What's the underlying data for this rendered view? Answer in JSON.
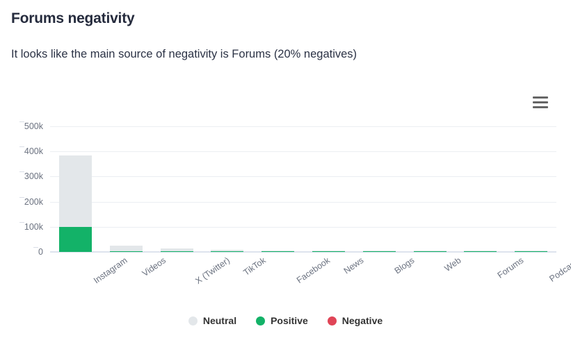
{
  "header": {
    "title": "Forums negativity",
    "subtitle": "It looks like the main source of negativity is Forums (20% negatives)"
  },
  "toolbar": {
    "menu_label": "Chart context menu",
    "menu_icon": "hamburger-menu-icon"
  },
  "colors": {
    "neutral": "#e3e7ea",
    "positive": "#13b268",
    "negative": "#e04557",
    "gridline": "#ebeef2",
    "axis": "#dde3ee",
    "tick_text": "#6b7280",
    "title_text": "#252b3d"
  },
  "chart_data": {
    "type": "bar",
    "subtype": "stacked-column",
    "title": "Forums negativity",
    "subtitle": "It looks like the main source of negativity is Forums (20% negatives)",
    "xlabel": "",
    "ylabel": "",
    "ylim": [
      0,
      500000
    ],
    "grid": true,
    "legend_position": "bottom",
    "categories": [
      "Instagram",
      "Videos",
      "X (Twitter)",
      "TikTok",
      "Facebook",
      "News",
      "Blogs",
      "Web",
      "Forums",
      "Podcasts"
    ],
    "ytick_labels": [
      "0",
      "100k",
      "200k",
      "300k",
      "400k",
      "500k"
    ],
    "ytick_values": [
      0,
      100000,
      200000,
      300000,
      400000,
      500000
    ],
    "series": [
      {
        "name": "Neutral",
        "color": "#e3e7ea",
        "values": [
          285000,
          23000,
          12000,
          7000,
          1200,
          700,
          500,
          400,
          300,
          200
        ]
      },
      {
        "name": "Positive",
        "color": "#13b268",
        "values": [
          100000,
          2500,
          1200,
          500,
          200,
          120,
          90,
          70,
          50,
          40
        ]
      },
      {
        "name": "Negative",
        "color": "#e04557",
        "values": [
          1500,
          400,
          200,
          120,
          60,
          40,
          30,
          25,
          75,
          15
        ]
      }
    ],
    "totals": [
      386500,
      25900,
      13400,
      7620,
      1460,
      860,
      620,
      495,
      425,
      255
    ]
  },
  "legend": {
    "items": [
      {
        "label": "Neutral",
        "color": "#e3e7ea"
      },
      {
        "label": "Positive",
        "color": "#13b268"
      },
      {
        "label": "Negative",
        "color": "#e04557"
      }
    ]
  }
}
